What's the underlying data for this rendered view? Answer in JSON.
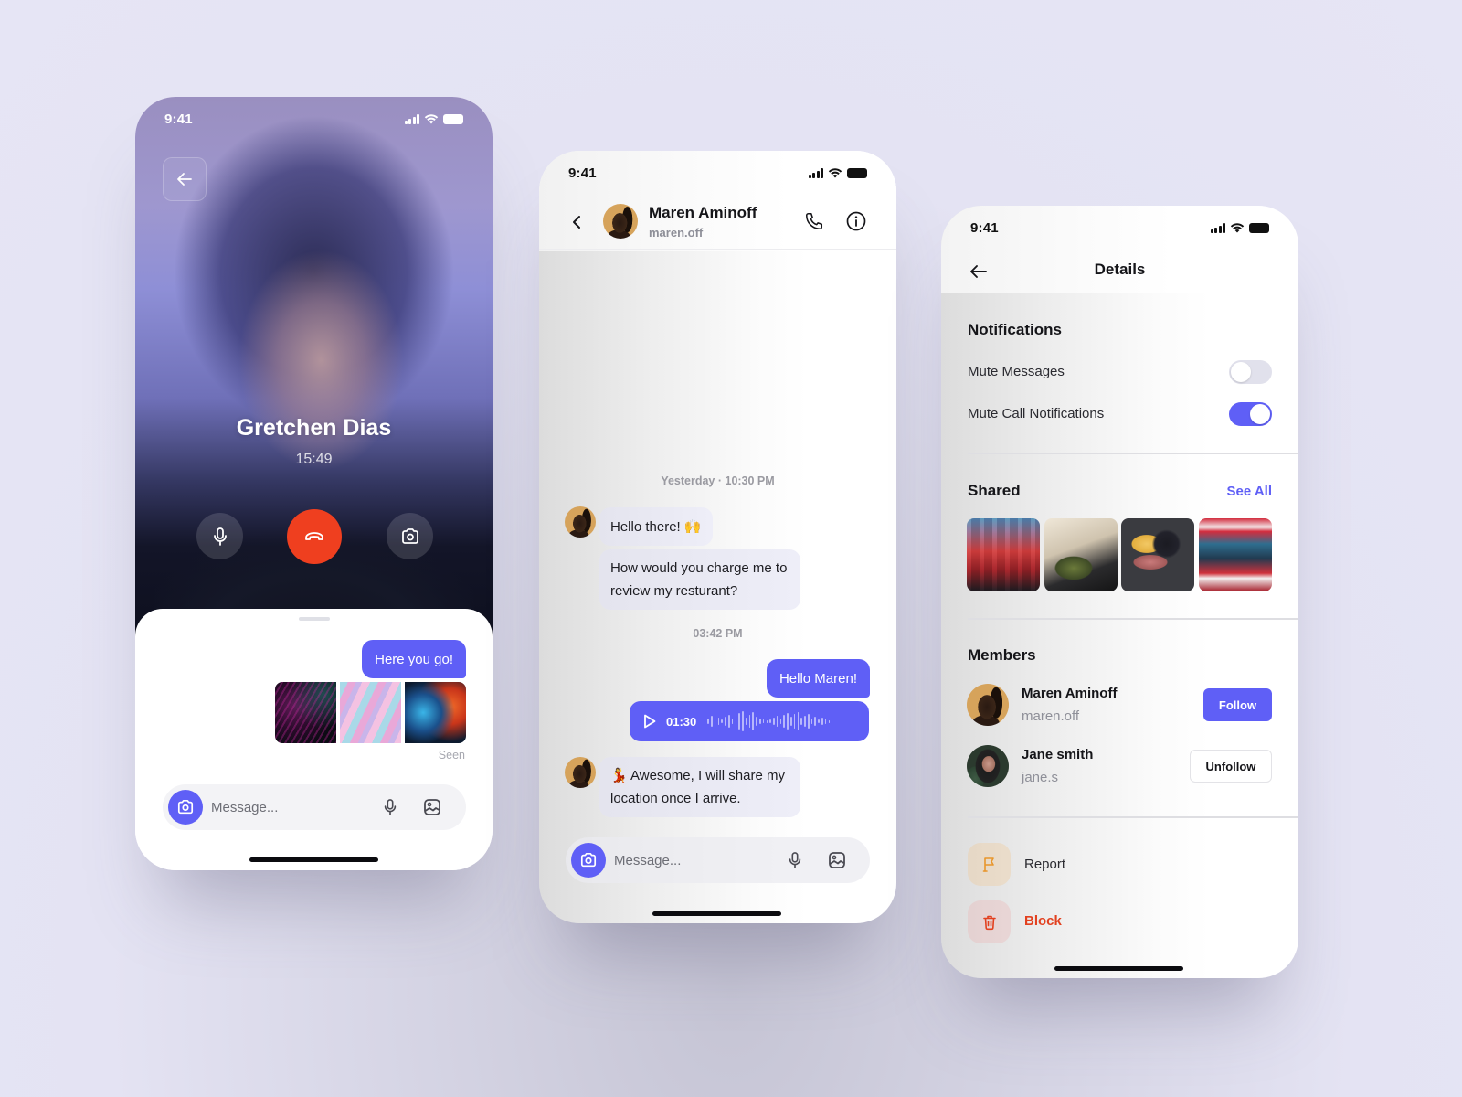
{
  "status_bar": {
    "time": "9:41"
  },
  "call_screen": {
    "caller_name": "Gretchen Dias",
    "duration": "15:49",
    "buttons": {
      "back": "back-arrow-icon",
      "mute": "microphone-icon",
      "end_call": "phone-hangup-icon",
      "camera": "camera-icon"
    },
    "sheet": {
      "outgoing_message": "Here you go!",
      "images": [
        "abstract-feathers-purple",
        "marble-pink-blue",
        "smoke-blue-orange"
      ],
      "status": "Seen"
    },
    "composer": {
      "placeholder": "Message..."
    }
  },
  "chat_screen": {
    "contact_name": "Maren Aminoff",
    "contact_username": "maren.off",
    "messages": [
      {
        "type": "timestamp",
        "text": "Yesterday · 10:30 PM"
      },
      {
        "type": "incoming",
        "text": "Hello there! 🙌"
      },
      {
        "type": "incoming",
        "text": "How would you charge me to review my resturant?"
      },
      {
        "type": "timestamp",
        "text": "03:42 PM"
      },
      {
        "type": "outgoing",
        "text": "Hello Maren!"
      },
      {
        "type": "voice",
        "duration": "01:30"
      },
      {
        "type": "incoming",
        "text": "💃 Awesome, I will share my location once I arrive."
      }
    ],
    "composer": {
      "placeholder": "Message..."
    }
  },
  "details_screen": {
    "title": "Details",
    "notifications": {
      "title": "Notifications",
      "items": [
        {
          "label": "Mute Messages",
          "enabled": false
        },
        {
          "label": "Mute Call Notifications",
          "enabled": true
        }
      ]
    },
    "shared": {
      "title": "Shared",
      "see_all": "See All",
      "images": [
        "diner-booths",
        "plated-salad",
        "cheese-olives-board",
        "retro-diner-interior"
      ]
    },
    "members": {
      "title": "Members",
      "list": [
        {
          "name": "Maren Aminoff",
          "username": "maren.off",
          "action": "Follow"
        },
        {
          "name": "Jane smith",
          "username": "jane.s",
          "action": "Unfollow"
        }
      ]
    },
    "actions": [
      {
        "label": "Report",
        "icon": "flag-icon",
        "color": "#e8962c"
      },
      {
        "label": "Block",
        "icon": "trash-icon",
        "color": "#e2401f"
      }
    ]
  },
  "colors": {
    "accent": "#5f5ff6",
    "end_call": "#ef3f1f",
    "danger": "#e2401f",
    "warning": "#e8962c",
    "background": "#e5e4f4"
  }
}
